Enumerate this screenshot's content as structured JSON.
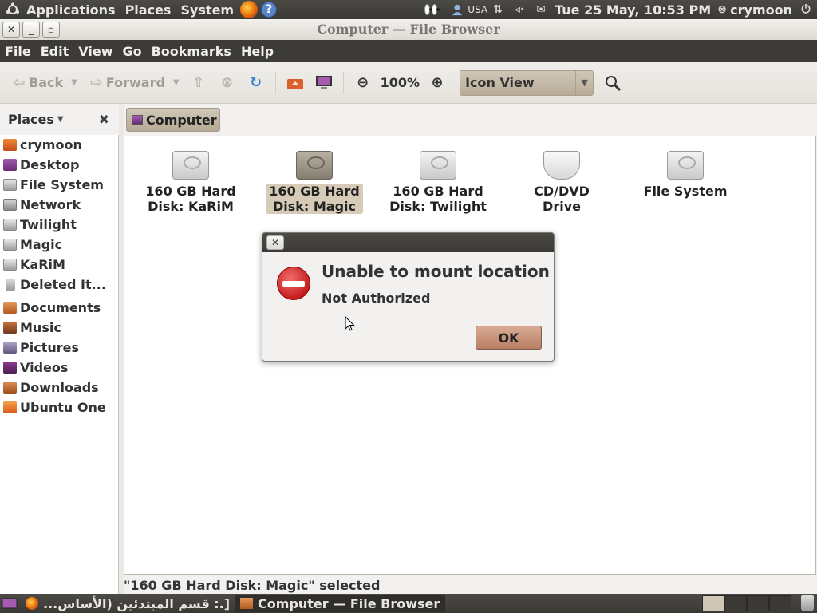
{
  "top_panel": {
    "menus": [
      "Applications",
      "Places",
      "System"
    ],
    "keyboard_layout": "USA",
    "datetime": "Tue 25 May, 10:53 PM",
    "user": "crymoon"
  },
  "window": {
    "title": "Computer — File Browser",
    "close_glyph": "✕",
    "min_glyph": "_",
    "max_glyph": "▫"
  },
  "menubar": [
    "File",
    "Edit",
    "View",
    "Go",
    "Bookmarks",
    "Help"
  ],
  "toolbar": {
    "back_label": "Back",
    "forward_label": "Forward",
    "zoom_level": "100%",
    "view_mode": "Icon View"
  },
  "sidebar": {
    "header": "Places",
    "items": [
      {
        "label": "crymoon",
        "icon": "home-folder-icon"
      },
      {
        "label": "Desktop",
        "icon": "desktop-icon"
      },
      {
        "label": "File System",
        "icon": "drive-icon"
      },
      {
        "label": "Network",
        "icon": "network-icon"
      },
      {
        "label": "Twilight",
        "icon": "drive-icon"
      },
      {
        "label": "Magic",
        "icon": "drive-icon"
      },
      {
        "label": "KaRiM",
        "icon": "drive-icon"
      },
      {
        "label": "Deleted It...",
        "icon": "trash-icon"
      },
      {
        "label": "Documents",
        "icon": "folder-icon"
      },
      {
        "label": "Music",
        "icon": "music-folder-icon"
      },
      {
        "label": "Pictures",
        "icon": "pictures-folder-icon"
      },
      {
        "label": "Videos",
        "icon": "videos-folder-icon"
      },
      {
        "label": "Downloads",
        "icon": "downloads-folder-icon"
      },
      {
        "label": "Ubuntu One",
        "icon": "ubuntu-one-folder-icon"
      }
    ]
  },
  "location": {
    "current": "Computer"
  },
  "content": {
    "items": [
      {
        "line1": "160 GB Hard",
        "line2": "Disk: KaRiM",
        "icon": "hard-disk-icon",
        "selected": false
      },
      {
        "line1": "160 GB Hard",
        "line2": "Disk: Magic",
        "icon": "hard-disk-icon",
        "selected": true
      },
      {
        "line1": "160 GB Hard",
        "line2": "Disk: Twilight",
        "icon": "hard-disk-icon",
        "selected": false
      },
      {
        "line1": "CD/DVD Drive",
        "line2": "",
        "icon": "optical-drive-icon",
        "selected": false
      },
      {
        "line1": "File System",
        "line2": "",
        "icon": "hard-disk-icon",
        "selected": false
      }
    ]
  },
  "statusbar": {
    "text": "\"160 GB Hard Disk: Magic\" selected"
  },
  "dialog": {
    "heading": "Unable to mount location",
    "message": "Not Authorized",
    "ok_label": "OK",
    "close_glyph": "✕"
  },
  "taskbar": {
    "tasks": [
      {
        "label": "[.: قسم المبتدئين (الأساس...",
        "active": false
      },
      {
        "label": "Computer — File Browser",
        "active": true
      }
    ]
  },
  "colors": {
    "panel": "#3c3b37",
    "selection": "#d6cbb6",
    "accent": "#b97e62",
    "error": "#c61e1e"
  }
}
